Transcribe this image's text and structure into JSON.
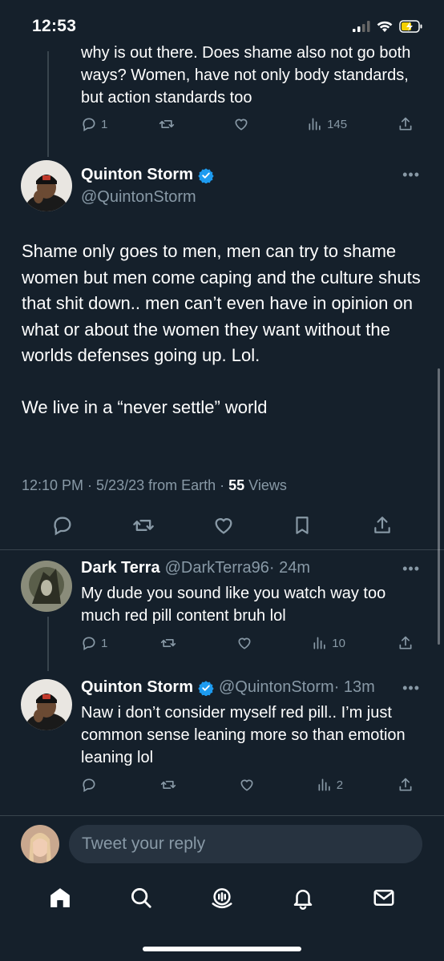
{
  "status_bar": {
    "time": "12:53"
  },
  "prev_tweet": {
    "text": "why is out there. Does shame also not go both ways? Women, have not only body standards, but action standards too",
    "reply_count": "1",
    "view_count": "145"
  },
  "main_tweet": {
    "display_name": "Quinton Storm",
    "handle": "@QuintonStorm",
    "body_p1": "Shame only goes to men, men can try to shame women but men come caping and the culture shuts that shit down.. men can’t even have in opinion on what or about the women they want without the worlds defenses going up. Lol.",
    "body_p2": "We live in a “never settle” world",
    "meta": "12:10 PM · 5/23/23 from Earth · ",
    "views_count": "55",
    "views_label": " Views"
  },
  "replies": [
    {
      "display_name": "Dark Terra",
      "handle": "@DarkTerra96",
      "time": " · 24m",
      "text": "My dude you sound like you watch way too much red pill content bruh lol",
      "reply_count": "1",
      "view_count": "10"
    },
    {
      "display_name": "Quinton Storm",
      "handle": "@QuintonStorm",
      "time": " · 13m",
      "text": "Naw i don’t consider myself red pill.. I’m just common sense leaning more so than emotion leaning lol",
      "reply_count": "",
      "view_count": "2"
    }
  ],
  "reply_bar": {
    "placeholder": "Tweet your reply"
  },
  "tabs": [
    "home-icon",
    "search-icon",
    "spaces-icon",
    "notifications-icon",
    "messages-icon"
  ],
  "colors": {
    "background": "#15202b",
    "muted": "#8899a6",
    "verified": "#1d9bf0",
    "divider": "#38444d"
  }
}
